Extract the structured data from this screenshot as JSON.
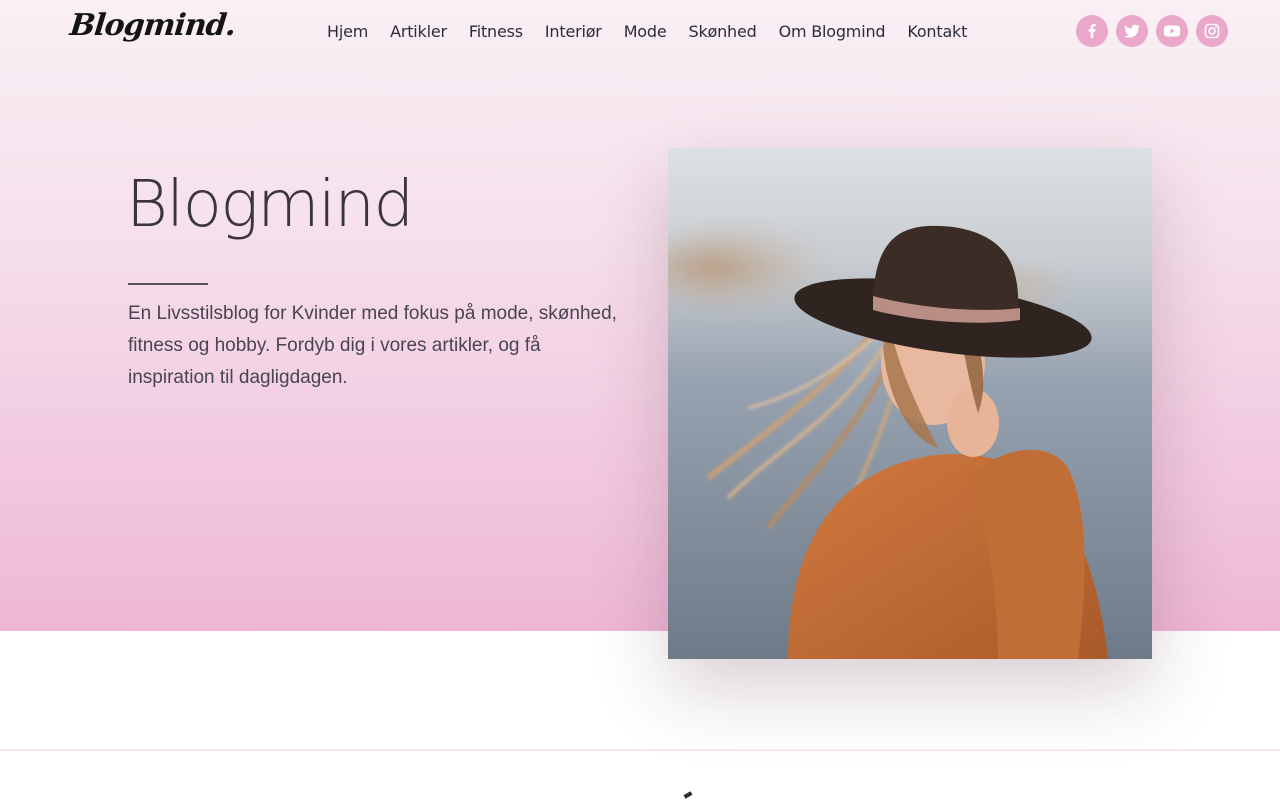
{
  "site": {
    "logo_text": "Blogmind.",
    "nav": [
      "Hjem",
      "Artikler",
      "Fitness",
      "Interiør",
      "Mode",
      "Skønhed",
      "Om Blogmind",
      "Kontakt"
    ],
    "social": [
      {
        "name": "facebook-icon"
      },
      {
        "name": "twitter-icon"
      },
      {
        "name": "youtube-icon"
      },
      {
        "name": "instagram-icon"
      }
    ]
  },
  "hero": {
    "title": "Blogmind",
    "intro": "En Livsstilsblog for Kvinder med fokus på mode, skønhed, fitness og hobby. Fordyb dig i vores artikler, og få inspiration til dagligdagen."
  },
  "colors": {
    "accent": "#e9a8c9",
    "gradient_top": "#f9f0f5",
    "gradient_bottom": "#edb7d5",
    "text": "#3a3440"
  }
}
